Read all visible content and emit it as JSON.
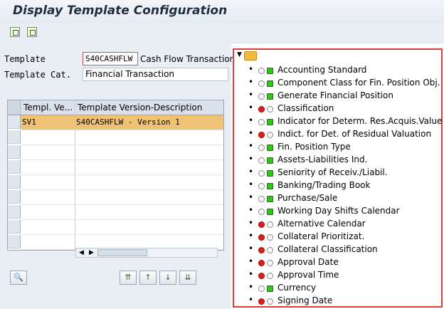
{
  "window": {
    "title": "Display Template Configuration"
  },
  "toolbar": {
    "icons": [
      "expand-all-icon",
      "collapse-all-icon"
    ]
  },
  "form": {
    "template_label": "Template",
    "template_value": "S40CASHFLW",
    "template_desc": "Cash Flow Transaction",
    "category_label": "Template Cat.",
    "category_value": "Financial Transaction"
  },
  "versions": {
    "columns": [
      "Templ. Ve...",
      "Template Version-Description"
    ],
    "rows": [
      {
        "version": "SV1",
        "description": "S40CASHFLW - Version 1",
        "selected": true
      }
    ]
  },
  "tree": {
    "items": [
      {
        "label": "Accounting Standard",
        "status": "green"
      },
      {
        "label": "Component Class for Fin. Position Obj.",
        "status": "green"
      },
      {
        "label": "Generate Financial Position",
        "status": "green"
      },
      {
        "label": "Classification",
        "status": "red"
      },
      {
        "label": "Indicator for Determ. Res.Acquis.Value",
        "status": "green"
      },
      {
        "label": "Indict. for Det. of Residual Valuation",
        "status": "red"
      },
      {
        "label": "Fin. Position Type",
        "status": "green"
      },
      {
        "label": "Assets-Liabilities Ind.",
        "status": "green"
      },
      {
        "label": "Seniority of Receiv./Liabil.",
        "status": "green"
      },
      {
        "label": "Banking/Trading Book",
        "status": "green"
      },
      {
        "label": "Purchase/Sale",
        "status": "green"
      },
      {
        "label": "Working Day Shifts Calendar",
        "status": "green"
      },
      {
        "label": "Alternative Calendar",
        "status": "red"
      },
      {
        "label": "Collateral Prioritizat.",
        "status": "red"
      },
      {
        "label": "Collateral Classification",
        "status": "red"
      },
      {
        "label": "Approval Date",
        "status": "red"
      },
      {
        "label": "Approval Time",
        "status": "red"
      },
      {
        "label": "Currency",
        "status": "green"
      },
      {
        "label": "Signing Date",
        "status": "red"
      }
    ]
  },
  "colors": {
    "highlight_row": "#f0c274",
    "tree_border": "#e03a3a",
    "light_red": "#e21b1b",
    "light_green": "#35c21e"
  }
}
